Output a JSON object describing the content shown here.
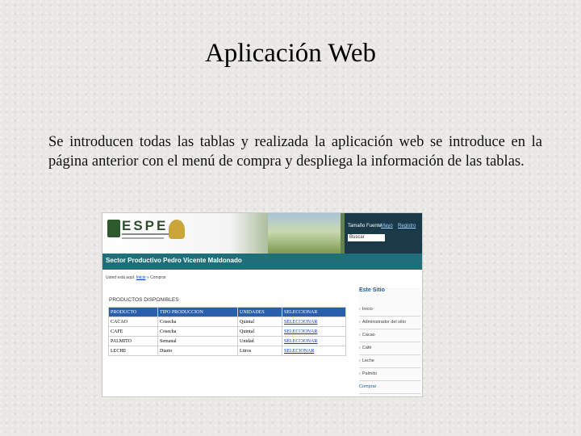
{
  "slide": {
    "title": "Aplicación Web",
    "body": "Se introducen todas las tablas y realizada la aplicación web se introduce en la página anterior con el menú de compra y despliega la información de las tablas."
  },
  "app": {
    "logo_text": "ESPE",
    "size_label": "Tamaño Fuente",
    "link_a": "Mayo",
    "link_b": "Registro",
    "search_value": "Buscar",
    "banner": "Sector Productivo Pedro Vicente Maldonado",
    "breadcrumb_prefix": "Usted está aquí:",
    "breadcrumb_link": "Inicio",
    "breadcrumb_current": "Comprar",
    "products_title": "PRODUCTOS DISPONIBLES",
    "table": {
      "headers": [
        "PRODUCTO",
        "TIPO PRODUCCION",
        "UNIDADES",
        "SELECCIONAR"
      ],
      "rows": [
        [
          "CACAO",
          "Cosecha",
          "Quintal",
          "SELECCIONAR"
        ],
        [
          "CAFE",
          "Cosecha",
          "Quintal",
          "SELECCIONAR"
        ],
        [
          "PALMITO",
          "Semanal",
          "Unidad",
          "SELECCIONAR"
        ],
        [
          "LECHE",
          "Diario",
          "Litros",
          "SELECIONAR"
        ]
      ]
    },
    "sidebar": {
      "title": "Este Sitio",
      "items": [
        "Inicio",
        "Administrador del sitio",
        "Cacao",
        "Café",
        "Leche",
        "Palmito",
        "Comprar"
      ]
    },
    "colors": {
      "banner": "#1f6f7a",
      "table_header": "#2a5fae",
      "link": "#0033cc"
    }
  }
}
